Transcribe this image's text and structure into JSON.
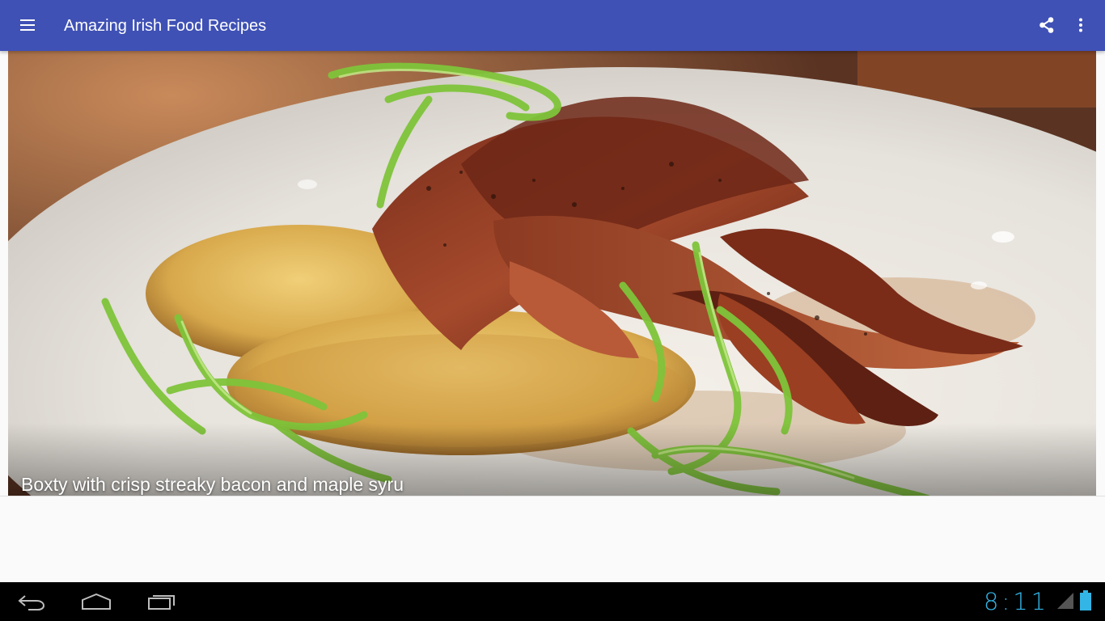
{
  "appbar": {
    "title": "Amazing Irish Food Recipes",
    "icons": [
      "menu-icon",
      "share-icon",
      "more-vert-icon"
    ],
    "color": "#3f51b5"
  },
  "recipe": {
    "caption": "Boxty with crisp streaky bacon and maple syru"
  },
  "system_bar": {
    "time": "8:11",
    "clock_color": "#33b5e5",
    "icons": [
      "back-icon",
      "home-icon",
      "recent-apps-icon",
      "signal-icon",
      "battery-icon"
    ]
  }
}
